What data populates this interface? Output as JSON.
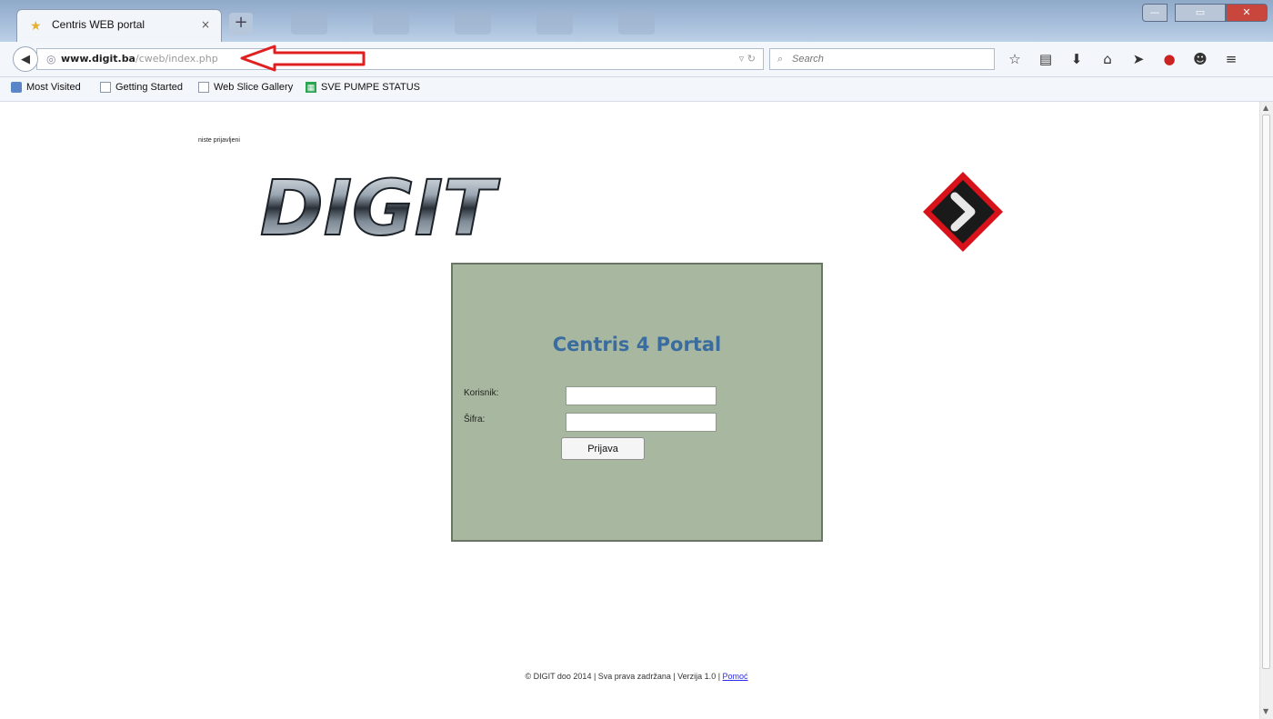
{
  "browser": {
    "tab_title": "Centris WEB portal",
    "tab_close": "×",
    "new_tab": "+",
    "url_host": "www.digit.ba",
    "url_path": "/cweb/index.php",
    "search_placeholder": "Search",
    "window_buttons": {
      "minimize": "—",
      "maximize": "▭",
      "close": "✕"
    }
  },
  "bookmarks": [
    {
      "label": "Most Visited"
    },
    {
      "label": "Getting Started"
    },
    {
      "label": "Web Slice Gallery"
    },
    {
      "label": "SVE PUMPE STATUS"
    }
  ],
  "page": {
    "status_text": "niste prijavljeni",
    "logo_text": "DIGIT",
    "login": {
      "title": "Centris 4 Portal",
      "user_label": "Korisnik:",
      "password_label": "Šifra:",
      "user_value": "",
      "password_value": "",
      "submit_label": "Prijava"
    },
    "footer": {
      "text": "© DIGIT doo 2014 | Sva prava zadržana | Verzija 1.0 | ",
      "help_link": "Pomoć"
    }
  },
  "colors": {
    "login_bg": "#a8b8a0",
    "title_color": "#3a6ca0",
    "annotation_arrow": "#e02020"
  }
}
